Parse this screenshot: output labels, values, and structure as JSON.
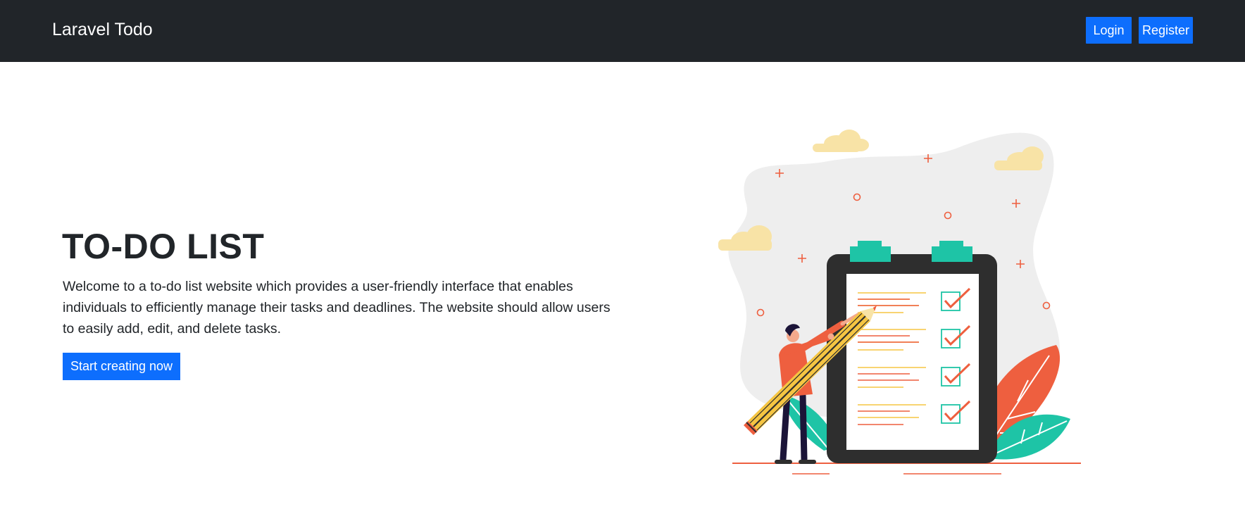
{
  "navbar": {
    "brand": "Laravel Todo",
    "login_label": "Login",
    "register_label": "Register"
  },
  "hero": {
    "title": "TO-DO LIST",
    "description": "Welcome to a to-do list website which provides a user-friendly interface that enables individuals to efficiently manage their tasks and deadlines. The website should allow users to easily add, edit, and delete tasks.",
    "cta_label": "Start creating now"
  },
  "illustration": {
    "icon": "todo-checklist-illustration",
    "checklist_items": 4
  },
  "colors": {
    "navbar_bg": "#212529",
    "primary": "#0d6efd",
    "text": "#212529",
    "accent_teal": "#1ec4a6",
    "accent_orange": "#ee5f3f",
    "accent_yellow": "#f5c542"
  }
}
